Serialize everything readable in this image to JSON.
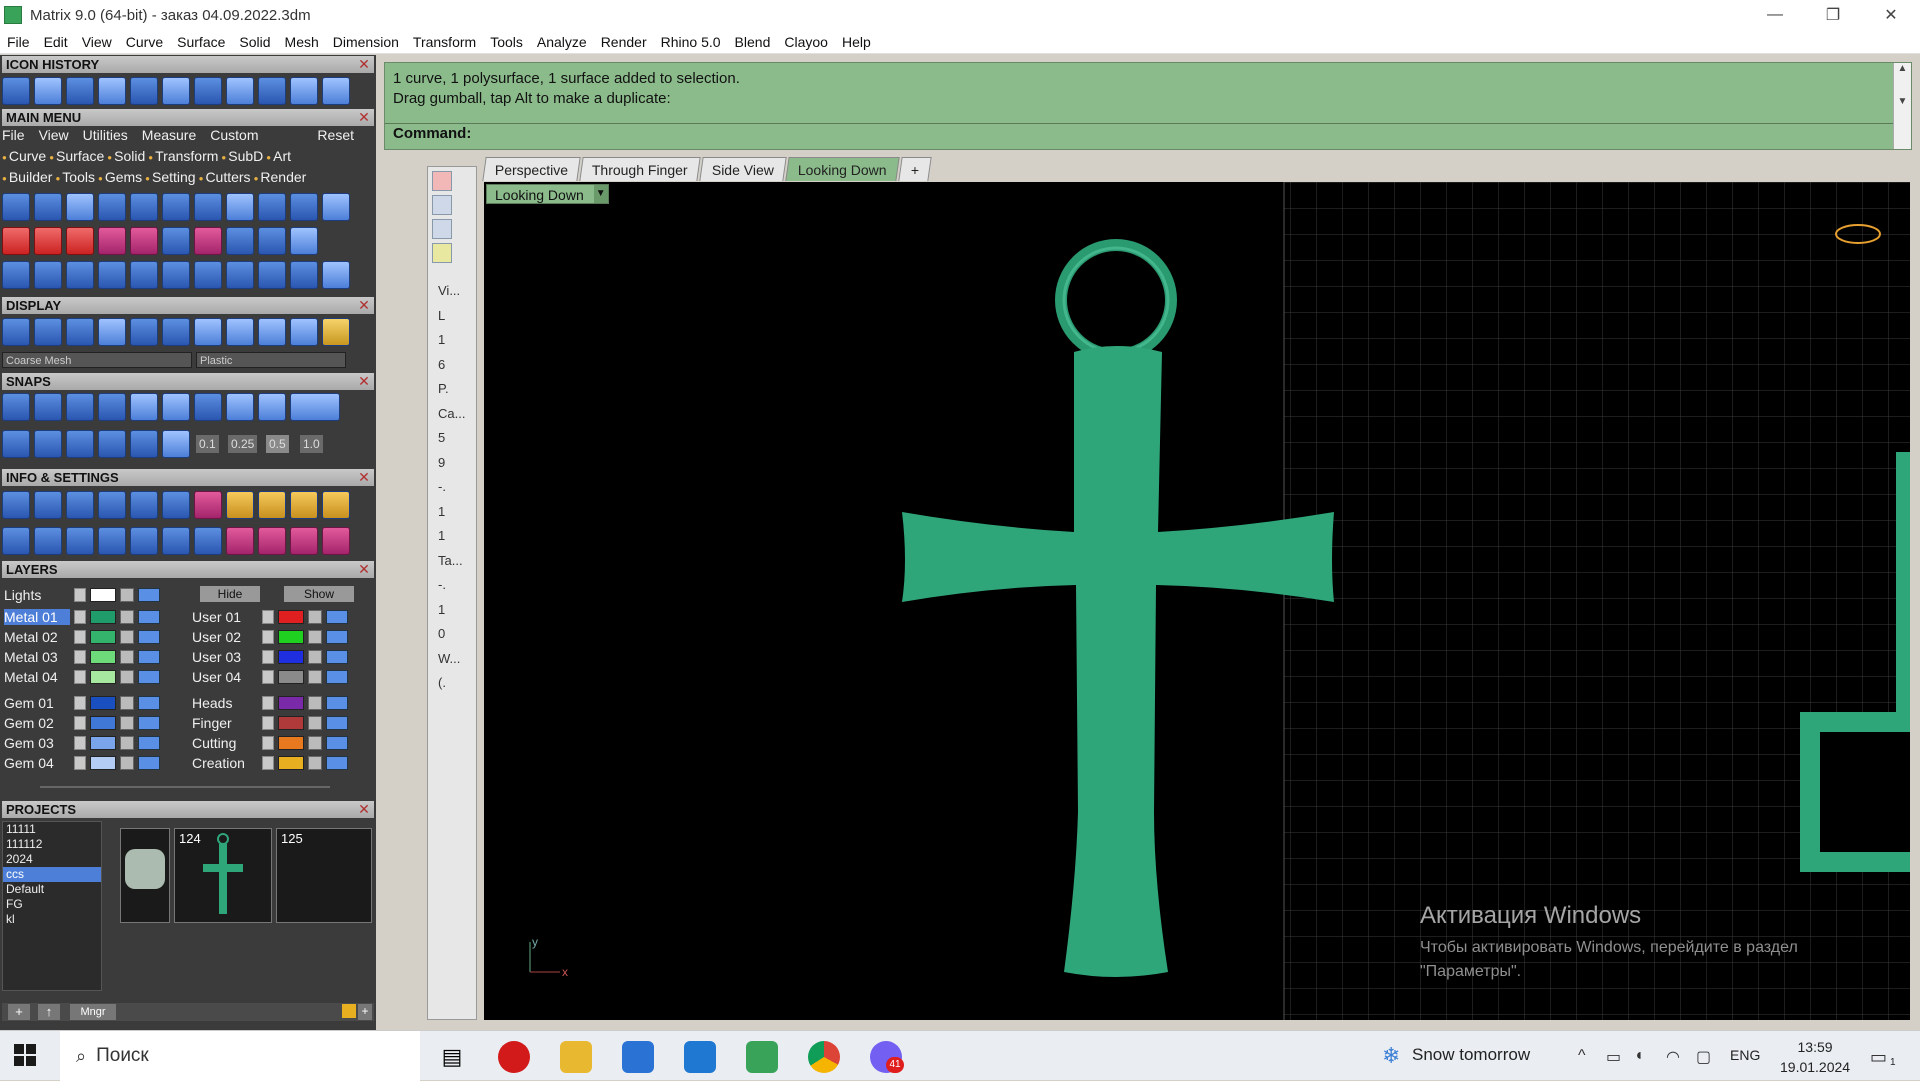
{
  "window": {
    "title": "Matrix 9.0 (64-bit) - заказ 04.09.2022.3dm",
    "controls": [
      "—",
      "❐",
      "✕"
    ]
  },
  "menubar": [
    "File",
    "Edit",
    "View",
    "Curve",
    "Surface",
    "Solid",
    "Mesh",
    "Dimension",
    "Transform",
    "Tools",
    "Analyze",
    "Render",
    "Rhino 5.0",
    "Blend",
    "Clayoo",
    "Help"
  ],
  "panels": {
    "icon_history": "ICON HISTORY",
    "main_menu": "MAIN MENU",
    "main_menu_items": [
      "File",
      "View",
      "Utilities",
      "Measure",
      "Custom"
    ],
    "main_menu_reset": "Reset",
    "categories_row1": [
      "Curve",
      "Surface",
      "Solid",
      "Transform",
      "SubD",
      "Art"
    ],
    "categories_row2": [
      "Builder",
      "Tools",
      "Gems",
      "Setting",
      "Cutters",
      "Render"
    ],
    "display": "DISPLAY",
    "display_mesh": "Coarse Mesh",
    "display_material": "Plastic",
    "snaps": "SNAPS",
    "snap_values": [
      "0.1",
      "0.25",
      "0.5",
      "1.0"
    ],
    "info_settings": "INFO & SETTINGS",
    "layers": "LAYERS",
    "projects": "PROJECTS"
  },
  "layers": {
    "lights": "Lights",
    "hide": "Hide",
    "show": "Show",
    "left": [
      {
        "name": "Metal 01",
        "color": "#1f9c6a",
        "selected": true
      },
      {
        "name": "Metal 02",
        "color": "#34b36c"
      },
      {
        "name": "Metal 03",
        "color": "#6edb7a"
      },
      {
        "name": "Metal 04",
        "color": "#a6e8a0"
      },
      {
        "name": "Gem 01",
        "color": "#1a4fbf"
      },
      {
        "name": "Gem 02",
        "color": "#3f78d6"
      },
      {
        "name": "Gem 03",
        "color": "#7aa5ea"
      },
      {
        "name": "Gem 04",
        "color": "#b3cdf5"
      }
    ],
    "right": [
      {
        "name": "User 01",
        "color": "#e02020"
      },
      {
        "name": "User 02",
        "color": "#20d020"
      },
      {
        "name": "User 03",
        "color": "#1f2fe0"
      },
      {
        "name": "User 04",
        "color": "#8a8a8a"
      },
      {
        "name": "Heads",
        "color": "#7a2aa8"
      },
      {
        "name": "Finger",
        "color": "#b03a3a"
      },
      {
        "name": "Cutting",
        "color": "#e8791f"
      },
      {
        "name": "Creation",
        "color": "#e8b020"
      }
    ]
  },
  "projects": {
    "list": [
      "11111",
      "111112",
      "2024",
      "ccs",
      "Default",
      "FG",
      "kl"
    ],
    "selected": "ccs",
    "thumbs": [
      "124",
      "125"
    ],
    "mngr": "Mngr"
  },
  "command": {
    "history_line1": "1 curve, 1 polysurface, 1 surface added to selection.",
    "history_line2": "Drag gumball, tap Alt to make a duplicate:",
    "prompt": "Command:"
  },
  "tabs": [
    {
      "label": "Perspective",
      "active": false
    },
    {
      "label": "Through Finger",
      "active": false
    },
    {
      "label": "Side View",
      "active": false
    },
    {
      "label": "Looking Down",
      "active": true
    },
    {
      "label": "+",
      "active": false
    }
  ],
  "viewport": {
    "label": "Looking Down",
    "axis_x": "x",
    "axis_y": "y",
    "object_color": "#2fa57a",
    "watermark_title": "Активация Windows",
    "watermark_text": "Чтобы активировать Windows, перейдите в раздел \"Параметры\"."
  },
  "side_strip": [
    "Vi...",
    "L",
    "1",
    "6",
    "P.",
    "Ca...",
    "5",
    "9",
    "-.",
    "1",
    "1",
    "Ta...",
    "-.",
    "1",
    "0",
    "W...",
    "(."
  ],
  "taskbar": {
    "search": "Поиск",
    "weather": "Snow tomorrow",
    "lang": "ENG",
    "time": "13:59",
    "date": "19.01.2024",
    "notifications": "1",
    "badge": "41"
  }
}
